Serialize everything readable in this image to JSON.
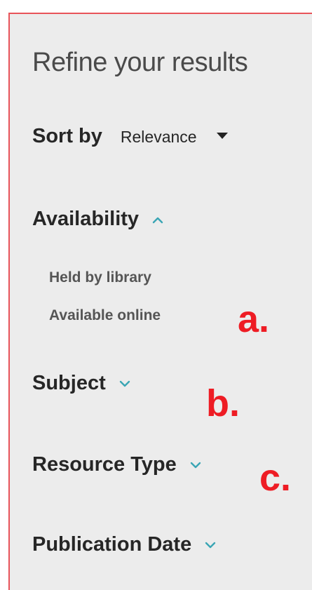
{
  "panel": {
    "title": "Refine your results",
    "border_color": "#e8545a",
    "background": "#ececec"
  },
  "sort": {
    "label": "Sort by",
    "selected": "Relevance",
    "icon": "caret-down-icon"
  },
  "facets": [
    {
      "label": "Availability",
      "expanded": true,
      "icon": "chevron-up-icon",
      "items": [
        {
          "label": "Held by library"
        },
        {
          "label": "Available online"
        }
      ]
    },
    {
      "label": "Subject",
      "expanded": false,
      "icon": "chevron-down-icon"
    },
    {
      "label": "Resource Type",
      "expanded": false,
      "icon": "chevron-down-icon"
    },
    {
      "label": "Publication Date",
      "expanded": false,
      "icon": "chevron-down-icon"
    }
  ],
  "annotations": {
    "a": "a.",
    "b": "b.",
    "c": "c.",
    "color": "#ee1c24"
  },
  "accent_color": "#3aa5b4"
}
